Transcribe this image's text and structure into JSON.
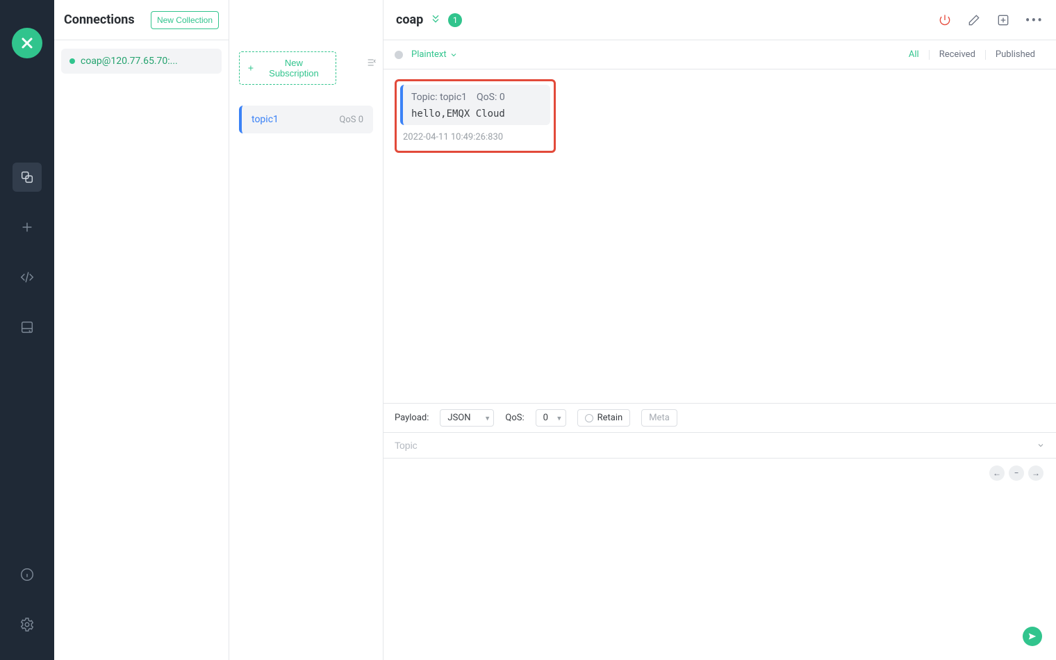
{
  "nav": {
    "items": [
      {
        "name": "collections-icon"
      },
      {
        "name": "plus-icon"
      },
      {
        "name": "code-icon"
      },
      {
        "name": "db-icon"
      }
    ],
    "bottom": [
      {
        "name": "info-icon"
      },
      {
        "name": "settings-icon"
      }
    ]
  },
  "connections": {
    "title": "Connections",
    "new_collection_label": "New Collection",
    "items": [
      {
        "label": "coap@120.77.65.70:...",
        "online": true
      }
    ]
  },
  "subs": {
    "new_sub_label": "New Subscription",
    "items": [
      {
        "topic": "topic1",
        "qos": "QoS 0"
      }
    ]
  },
  "topbar": {
    "title": "coap",
    "count": "1",
    "format_label": "Plaintext",
    "tabs": {
      "all": "All",
      "received": "Received",
      "published": "Published"
    }
  },
  "message": {
    "topic_label": "Topic: ",
    "topic": "topic1",
    "qos_label": "QoS: ",
    "qos": "0",
    "payload": "hello,EMQX Cloud",
    "timestamp": "2022-04-11 10:49:26:830"
  },
  "publish": {
    "payload_label": "Payload:",
    "payload_format": "JSON",
    "qos_label": "QoS:",
    "qos_value": "0",
    "retain_label": "Retain",
    "meta_label": "Meta",
    "topic_placeholder": "Topic"
  }
}
